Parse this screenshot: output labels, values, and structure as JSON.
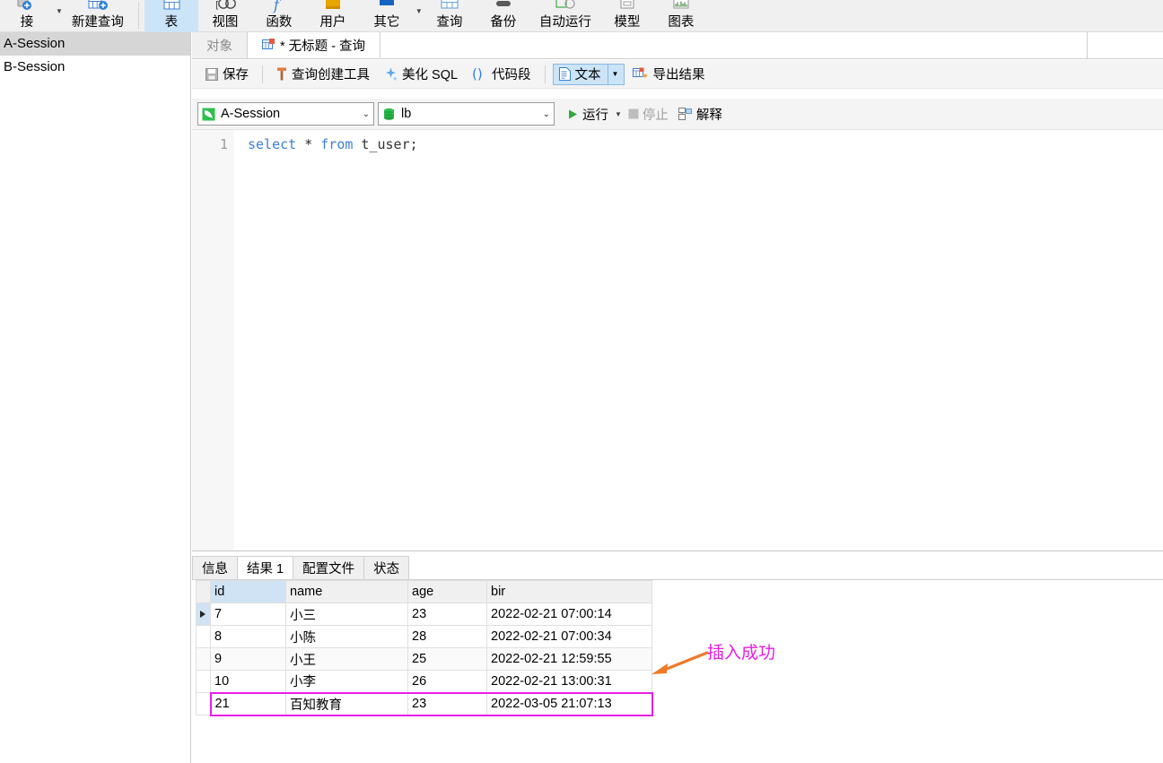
{
  "ribbon": {
    "groups": [
      {
        "items": [
          {
            "label": "接",
            "icon": "connection-icon",
            "has_caret": true,
            "active": false
          },
          {
            "label": "新建查询",
            "icon": "new-query-icon",
            "has_caret": false,
            "active": false
          }
        ]
      },
      {
        "items": [
          {
            "label": "表",
            "icon": "table-icon",
            "has_caret": false,
            "active": true
          },
          {
            "label": "视图",
            "icon": "view-icon",
            "has_caret": false,
            "active": false
          },
          {
            "label": "函数",
            "icon": "function-icon",
            "has_caret": false,
            "active": false
          },
          {
            "label": "用户",
            "icon": "user-icon",
            "has_caret": false,
            "active": false
          },
          {
            "label": "其它",
            "icon": "other-icon",
            "has_caret": true,
            "active": false
          },
          {
            "label": "查询",
            "icon": "query-icon",
            "has_caret": false,
            "active": false
          },
          {
            "label": "备份",
            "icon": "backup-icon",
            "has_caret": false,
            "active": false
          },
          {
            "label": "自动运行",
            "icon": "autorun-icon",
            "has_caret": false,
            "active": false
          },
          {
            "label": "模型",
            "icon": "model-icon",
            "has_caret": false,
            "active": false
          },
          {
            "label": "图表",
            "icon": "chart-icon",
            "has_caret": false,
            "active": false
          }
        ]
      }
    ]
  },
  "sidebar": {
    "sessions": [
      {
        "label": "A-Session",
        "selected": true
      },
      {
        "label": "B-Session",
        "selected": false
      }
    ]
  },
  "tabstrip": {
    "tabs": [
      {
        "label": "对象",
        "icon": null,
        "active": false
      },
      {
        "label": "* 无标题 - 查询",
        "icon": "query-tab-icon",
        "active": true
      }
    ]
  },
  "toolbar": {
    "save_label": "保存",
    "save_icon": "save-icon",
    "query_builder_label": "查询创建工具",
    "query_builder_icon": "query-builder-icon",
    "beautify_label": "美化 SQL",
    "beautify_icon": "beautify-icon",
    "snippet_label": "代码段",
    "snippet_icon": "snippet-icon",
    "text_label": "文本",
    "text_icon": "text-doc-icon",
    "text_caret_icon": "chevron-down-icon",
    "export_label": "导出结果",
    "export_icon": "export-icon"
  },
  "toolbar2": {
    "session_value": "A-Session",
    "session_icon": "session-icon",
    "database_value": "lb",
    "database_icon": "database-icon",
    "caret_icon": "chevron-down-icon",
    "run_label": "运行",
    "run_icon": "play-icon",
    "run_caret_icon": "chevron-down-icon",
    "stop_label": "停止",
    "stop_icon": "stop-icon",
    "explain_label": "解释",
    "explain_icon": "explain-icon"
  },
  "editor": {
    "line_number": "1",
    "code": {
      "kw1": "select",
      "star": " * ",
      "kw2": "from",
      "rest": " t_user;"
    }
  },
  "results": {
    "tabs": [
      {
        "label": "信息",
        "active": false
      },
      {
        "label": "结果 1",
        "active": true
      },
      {
        "label": "配置文件",
        "active": false
      },
      {
        "label": "状态",
        "active": false
      }
    ],
    "columns": [
      "id",
      "name",
      "age",
      "bir"
    ],
    "selected_column": "id",
    "rows": [
      {
        "indicator": true,
        "id": "7",
        "name": "小三",
        "age": "23",
        "bir": "2022-02-21 07:00:14",
        "alt": false,
        "highlight": false
      },
      {
        "indicator": false,
        "id": "8",
        "name": "小陈",
        "age": "28",
        "bir": "2022-02-21 07:00:34",
        "alt": false,
        "highlight": false
      },
      {
        "indicator": false,
        "id": "9",
        "name": "小王",
        "age": "25",
        "bir": "2022-02-21 12:59:55",
        "alt": true,
        "highlight": false
      },
      {
        "indicator": false,
        "id": "10",
        "name": "小李",
        "age": "26",
        "bir": "2022-02-21 13:00:31",
        "alt": false,
        "highlight": false
      },
      {
        "indicator": false,
        "id": "21",
        "name": "百知教育",
        "age": "23",
        "bir": "2022-03-05 21:07:13",
        "alt": false,
        "highlight": true
      }
    ]
  },
  "annotation": {
    "text": "插入成功",
    "text_color": "#e81ee8",
    "arrow_color": "#f07a2a",
    "arrow_icon": "arrow-left-icon",
    "highlight_color": "#e81ee8"
  },
  "colors": {
    "ribbon_bg": "#f0f0f0",
    "active_tab_blue": "#cce4f7",
    "selected_session_bg": "#d6d6d6",
    "grid_header_bg": "#f0f0f0",
    "grid_selected_header_bg": "#cfe3f5",
    "keyword_blue": "#3b7fd4"
  }
}
